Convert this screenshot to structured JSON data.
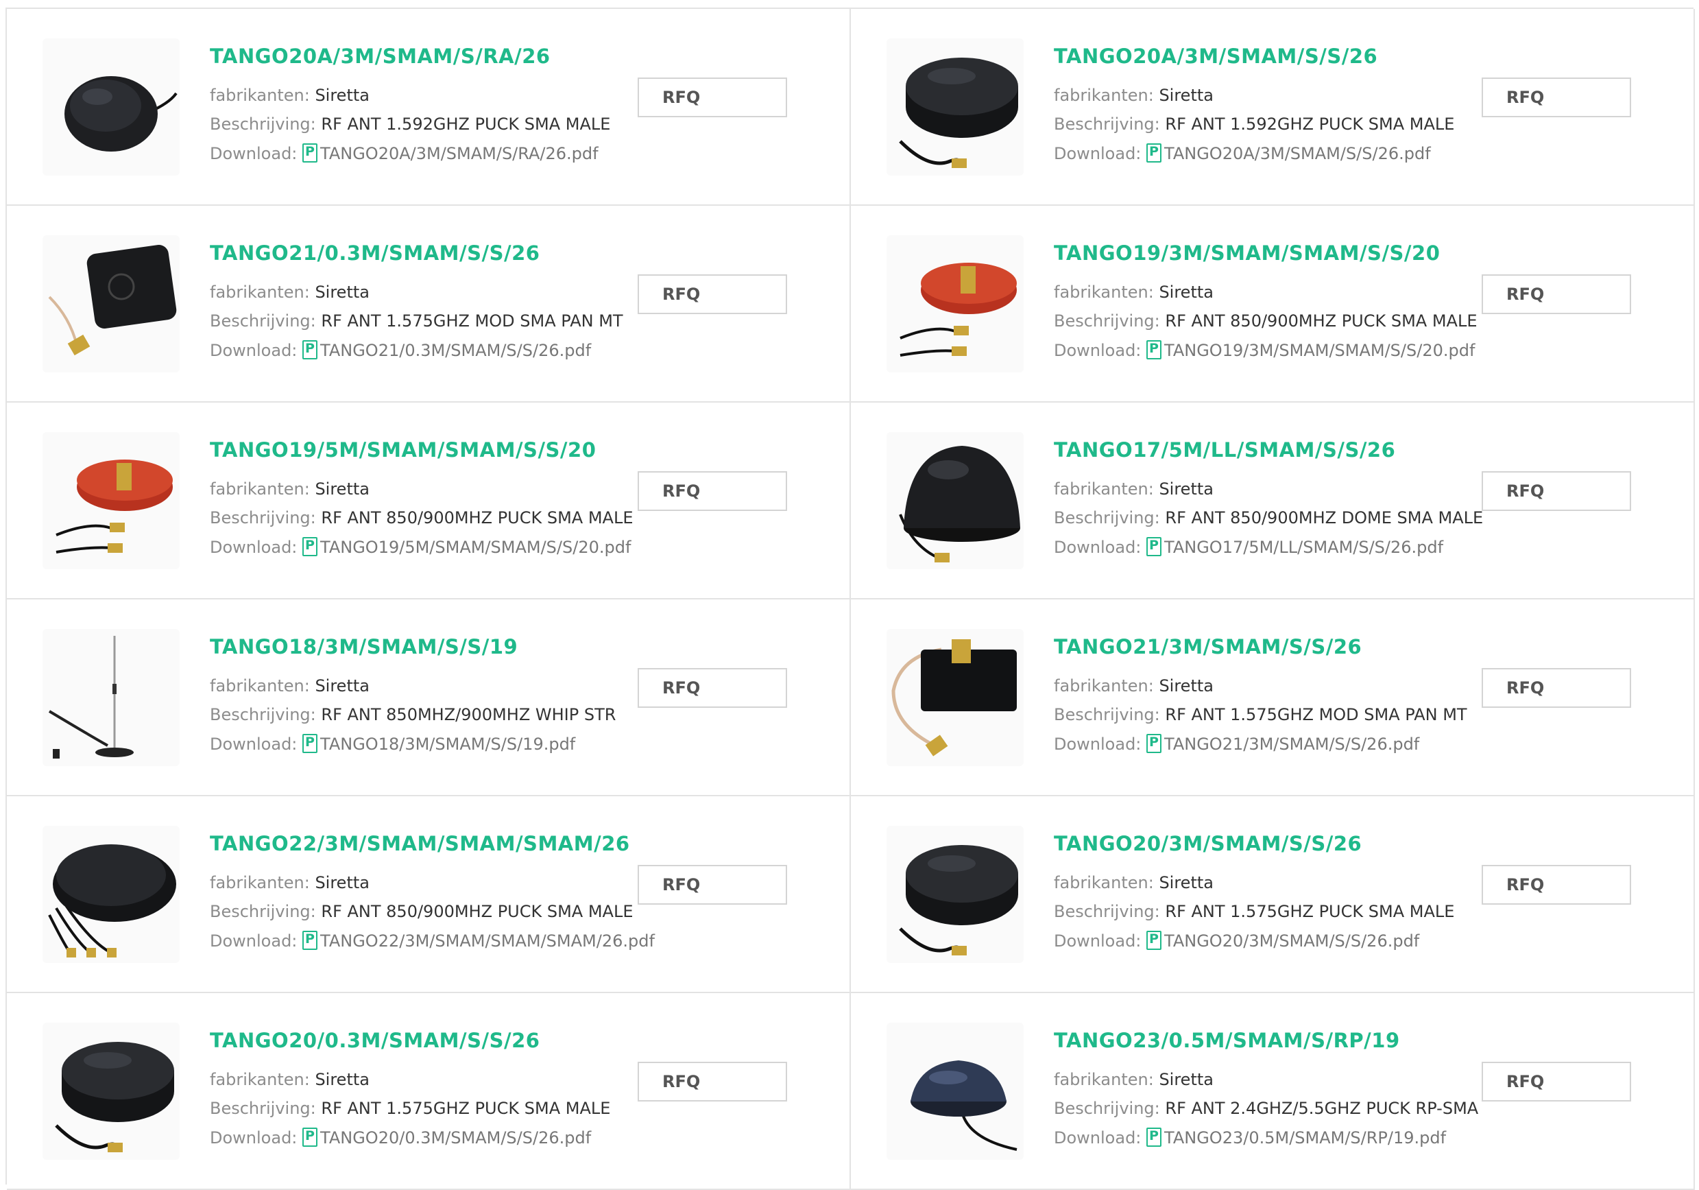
{
  "labels": {
    "manufacturer": "fabrikanten:",
    "description": "Beschrijving:",
    "download": "Download:",
    "rfq": "RFQ"
  },
  "colors": {
    "accent": "#1fb98a",
    "border": "#e3e3e3",
    "label": "#8c8c8c"
  },
  "products": [
    {
      "part": "TANGO20A/3M/SMAM/S/RA/26",
      "manufacturer": "Siretta",
      "description": "RF ANT 1.592GHZ PUCK SMA MALE",
      "file": "TANGO20A/3M/SMAM/S/RA/26.pdf",
      "image": "black-puck-antenna-side-cable"
    },
    {
      "part": "TANGO20A/3M/SMAM/S/S/26",
      "manufacturer": "Siretta",
      "description": "RF ANT 1.592GHZ PUCK SMA MALE",
      "file": "TANGO20A/3M/SMAM/S/S/26.pdf",
      "image": "black-puck-antenna-with-cable"
    },
    {
      "part": "TANGO21/0.3M/SMAM/S/S/26",
      "manufacturer": "Siretta",
      "description": "RF ANT 1.575GHZ MOD SMA PAN MT",
      "file": "TANGO21/0.3M/SMAM/S/S/26.pdf",
      "image": "square-gps-module-antenna"
    },
    {
      "part": "TANGO19/3M/SMAM/SMAM/S/S/20",
      "manufacturer": "Siretta",
      "description": "RF ANT 850/900MHZ PUCK SMA MALE",
      "file": "TANGO19/3M/SMAM/SMAM/S/S/20.pdf",
      "image": "red-base-puck-antenna"
    },
    {
      "part": "TANGO19/5M/SMAM/SMAM/S/S/20",
      "manufacturer": "Siretta",
      "description": "RF ANT 850/900MHZ PUCK SMA MALE",
      "file": "TANGO19/5M/SMAM/SMAM/S/S/20.pdf",
      "image": "red-base-puck-antenna"
    },
    {
      "part": "TANGO17/5M/LL/SMAM/S/S/26",
      "manufacturer": "Siretta",
      "description": "RF ANT 850/900MHZ DOME SMA MALE",
      "file": "TANGO17/5M/LL/SMAM/S/S/26.pdf",
      "image": "black-dome-antenna"
    },
    {
      "part": "TANGO18/3M/SMAM/S/S/19",
      "manufacturer": "Siretta",
      "description": "RF ANT 850MHZ/900MHZ WHIP STR",
      "file": "TANGO18/3M/SMAM/S/S/19.pdf",
      "image": "whip-antenna"
    },
    {
      "part": "TANGO21/3M/SMAM/S/S/26",
      "manufacturer": "Siretta",
      "description": "RF ANT 1.575GHZ MOD SMA PAN MT",
      "file": "TANGO21/3M/SMAM/S/S/26.pdf",
      "image": "square-panel-mount-antenna"
    },
    {
      "part": "TANGO22/3M/SMAM/SMAM/SMAM/26",
      "manufacturer": "Siretta",
      "description": "RF ANT 850/900MHZ PUCK SMA MALE",
      "file": "TANGO22/3M/SMAM/SMAM/SMAM/26.pdf",
      "image": "black-puck-three-cables"
    },
    {
      "part": "TANGO20/3M/SMAM/S/S/26",
      "manufacturer": "Siretta",
      "description": "RF ANT 1.575GHZ PUCK SMA MALE",
      "file": "TANGO20/3M/SMAM/S/S/26.pdf",
      "image": "black-puck-antenna-with-cable"
    },
    {
      "part": "TANGO20/0.3M/SMAM/S/S/26",
      "manufacturer": "Siretta",
      "description": "RF ANT 1.575GHZ PUCK SMA MALE",
      "file": "TANGO20/0.3M/SMAM/S/S/26.pdf",
      "image": "black-puck-antenna-with-cable"
    },
    {
      "part": "TANGO23/0.5M/SMAM/S/RP/19",
      "manufacturer": "Siretta",
      "description": "RF ANT 2.4GHZ/5.5GHZ PUCK RP-SMA",
      "file": "TANGO23/0.5M/SMAM/S/RP/19.pdf",
      "image": "low-profile-puck-antenna"
    }
  ]
}
